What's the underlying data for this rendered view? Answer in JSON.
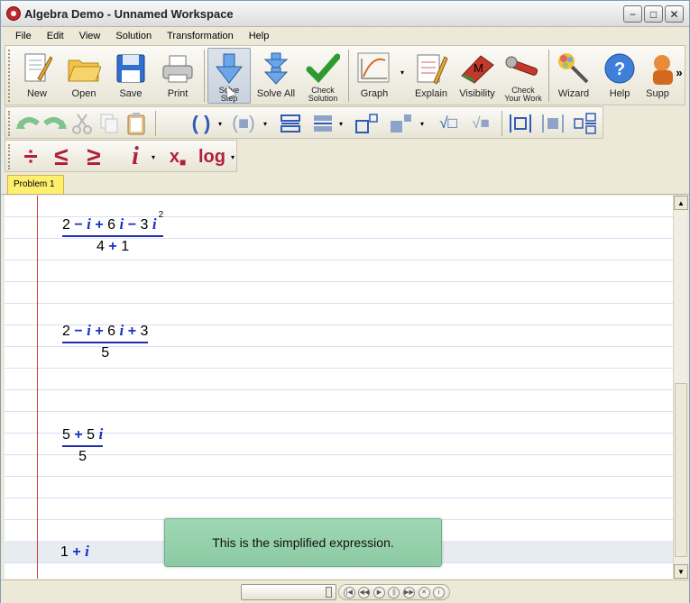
{
  "window": {
    "title": "Algebra Demo - Unnamed Workspace"
  },
  "menu": [
    "File",
    "Edit",
    "View",
    "Solution",
    "Transformation",
    "Help"
  ],
  "toolbar": {
    "new": "New",
    "open": "Open",
    "save": "Save",
    "print": "Print",
    "solve_step_1": "Solve",
    "solve_step_2": "Step",
    "solve_all": "Solve All",
    "check_solution_1": "Check",
    "check_solution_2": "Solution",
    "graph": "Graph",
    "explain": "Explain",
    "visibility": "Visibility",
    "check_work_1": "Check",
    "check_work_2": "Your Work",
    "wizard": "Wizard",
    "help": "Help",
    "support": "Supp",
    "more": "»"
  },
  "tabs": [
    "Problem 1"
  ],
  "steps": {
    "s1": {
      "num": [
        "2",
        "−",
        "i",
        "+",
        "6",
        "i",
        "−",
        "3",
        "i",
        "2"
      ],
      "den": [
        "4",
        "+",
        "1"
      ]
    },
    "s2": {
      "num": [
        "2",
        "−",
        "i",
        "+",
        "6",
        "i",
        "+",
        "3"
      ],
      "den": "5"
    },
    "s3": {
      "num": [
        "5",
        "+",
        "5",
        "i"
      ],
      "den": "5"
    },
    "s4": [
      "1",
      "+",
      "i"
    ]
  },
  "tooltip": "This is the simplified expression.",
  "colors": {
    "accent": "#1633c2",
    "margin_line": "#d03c3c",
    "tooltip_bg": "#9fd7b4",
    "tab_bg": "#ffef6e"
  }
}
